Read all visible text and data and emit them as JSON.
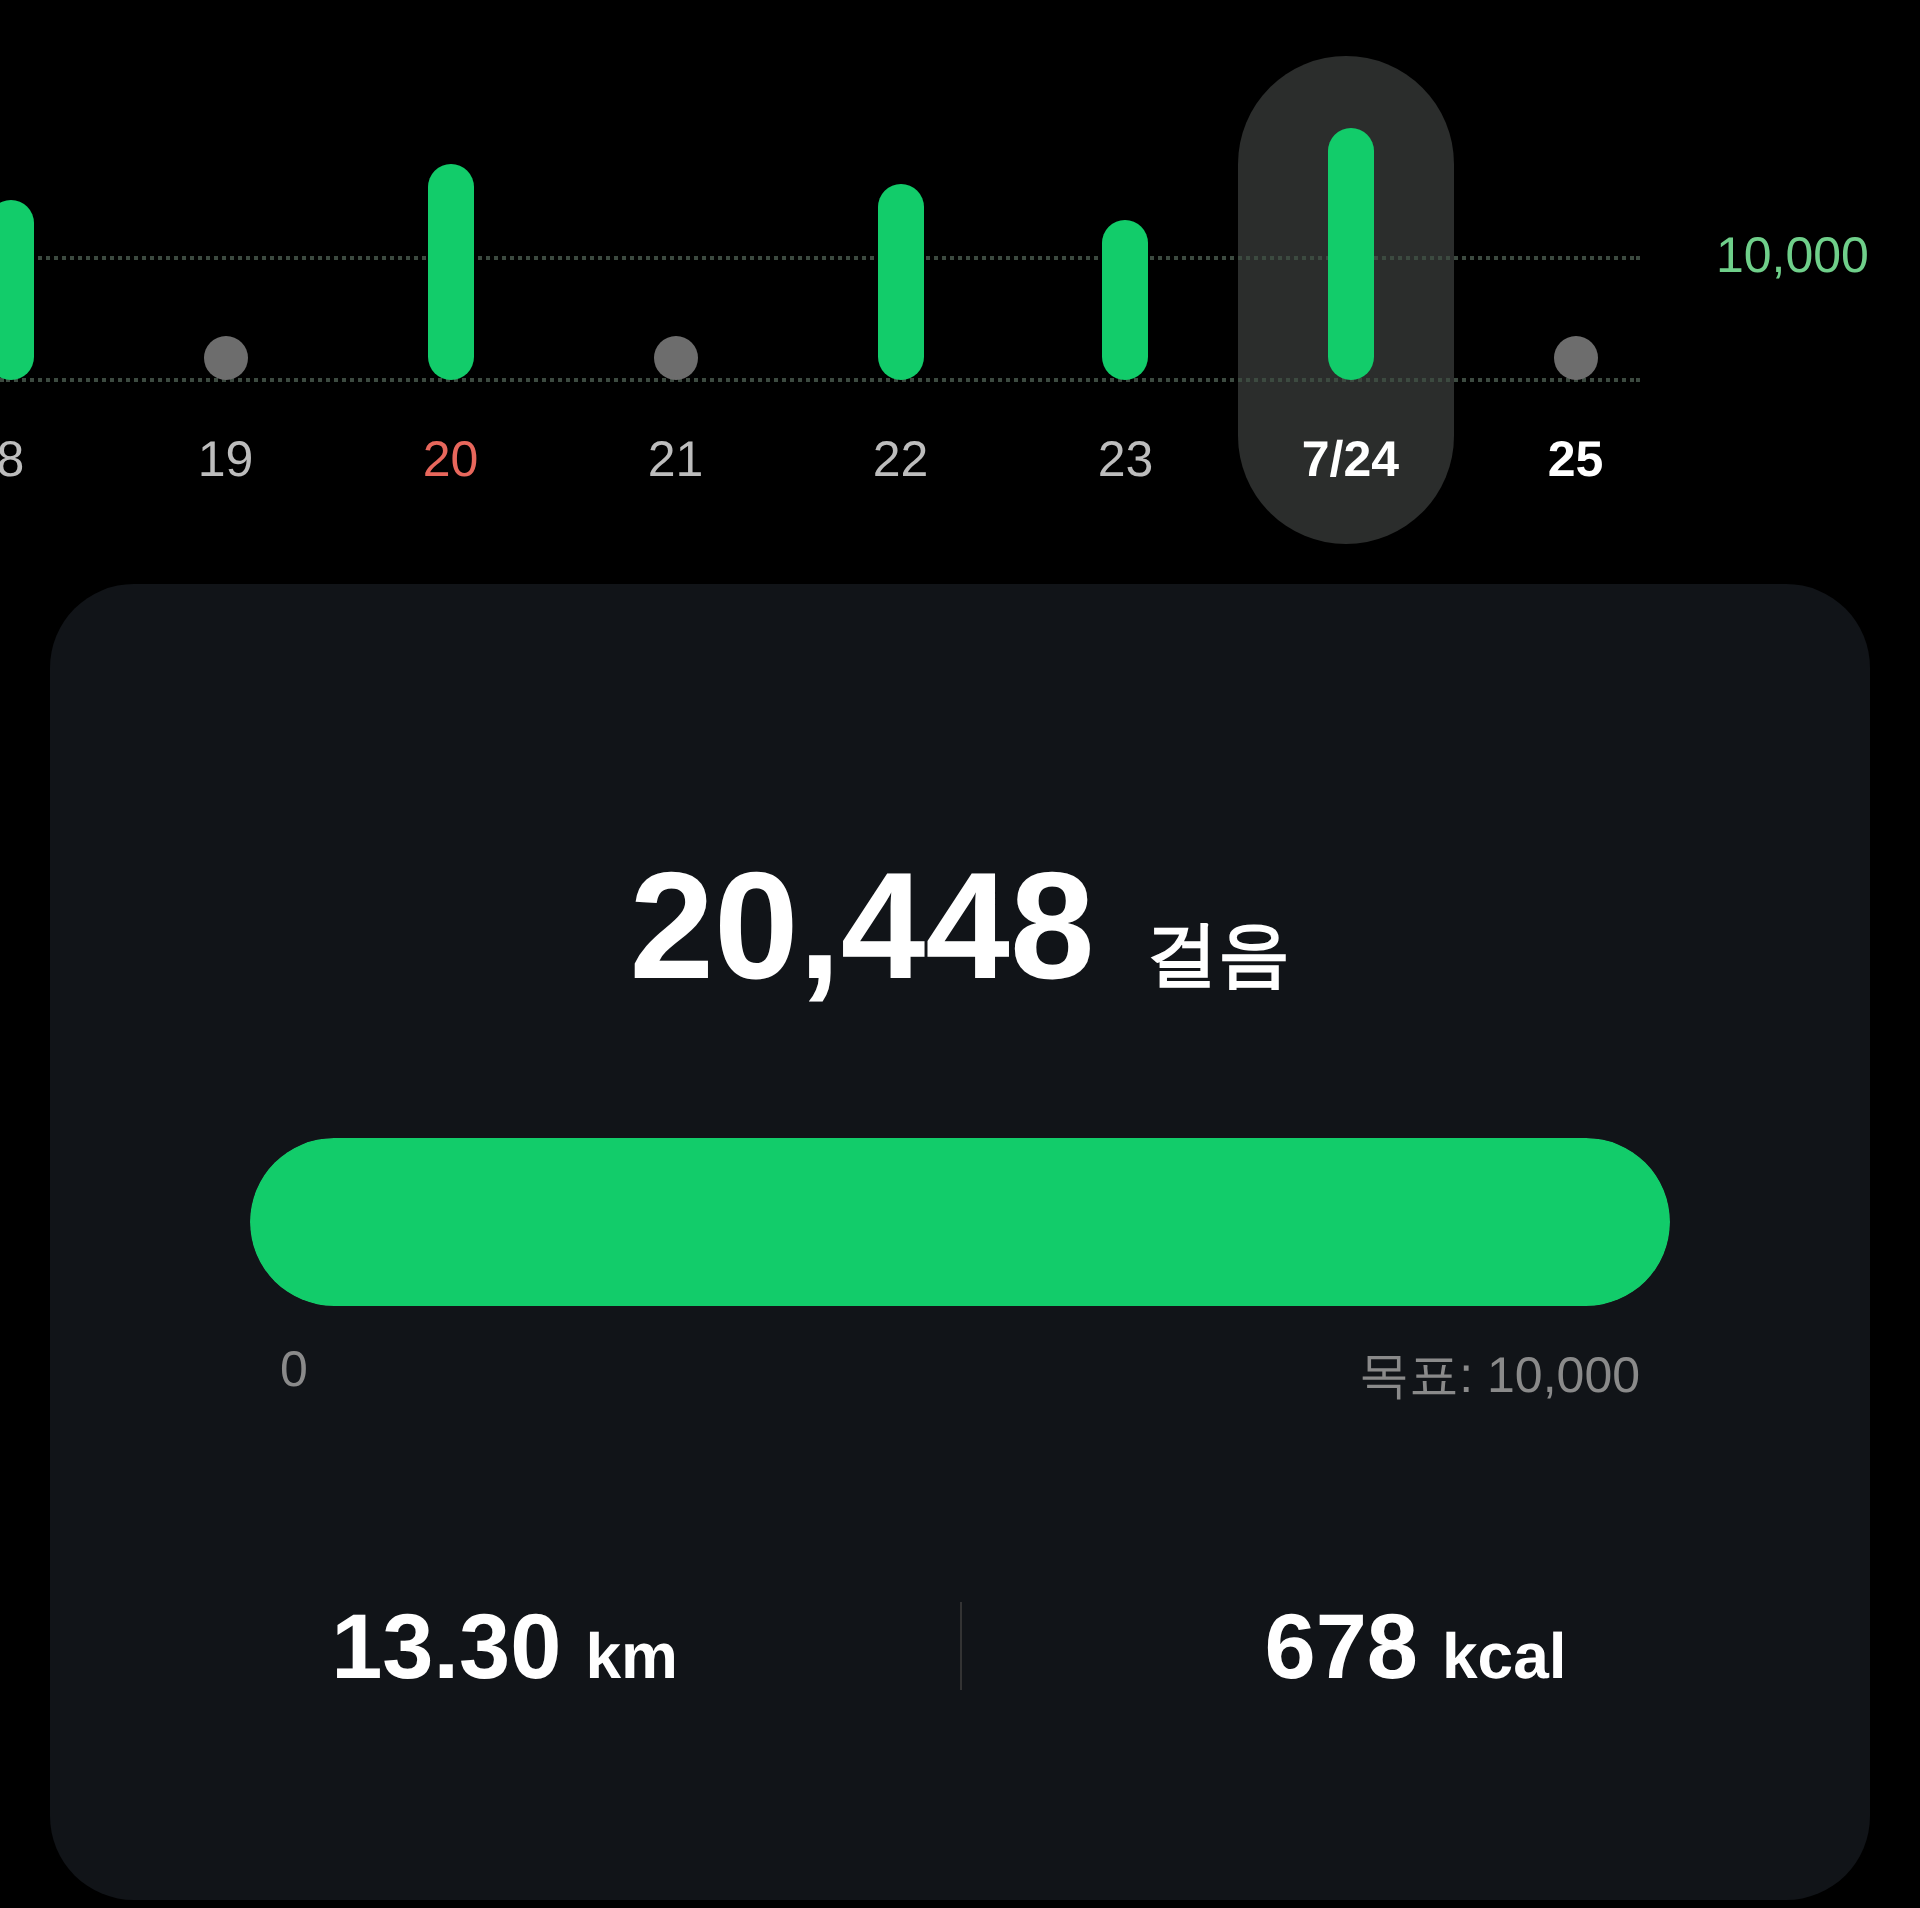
{
  "week_chart": {
    "goal_label": "10,000",
    "days": [
      {
        "label": "8",
        "kind": "bar",
        "selected": false,
        "bold": false,
        "color": "#bdbdbd"
      },
      {
        "label": "19",
        "kind": "dot",
        "selected": false,
        "bold": false,
        "color": "#bdbdbd"
      },
      {
        "label": "20",
        "kind": "bar",
        "selected": false,
        "bold": false,
        "color": "#e8675c"
      },
      {
        "label": "21",
        "kind": "dot",
        "selected": false,
        "bold": false,
        "color": "#bdbdbd"
      },
      {
        "label": "22",
        "kind": "bar",
        "selected": false,
        "bold": false,
        "color": "#bdbdbd"
      },
      {
        "label": "23",
        "kind": "bar",
        "selected": false,
        "bold": false,
        "color": "#bdbdbd"
      },
      {
        "label": "7/24",
        "kind": "bar",
        "selected": true,
        "bold": true,
        "color": "#ffffff"
      },
      {
        "label": "25",
        "kind": "dot",
        "selected": false,
        "bold": true,
        "color": "#ffffff"
      }
    ]
  },
  "summary": {
    "steps": "20,448",
    "steps_unit": "걸음",
    "progress": {
      "level": 1,
      "start_label": "0",
      "goal_label": "목표: 10,000"
    },
    "stats": [
      {
        "value": "13.30",
        "unit": "km"
      },
      {
        "value": "678",
        "unit": "kcal"
      }
    ]
  }
}
